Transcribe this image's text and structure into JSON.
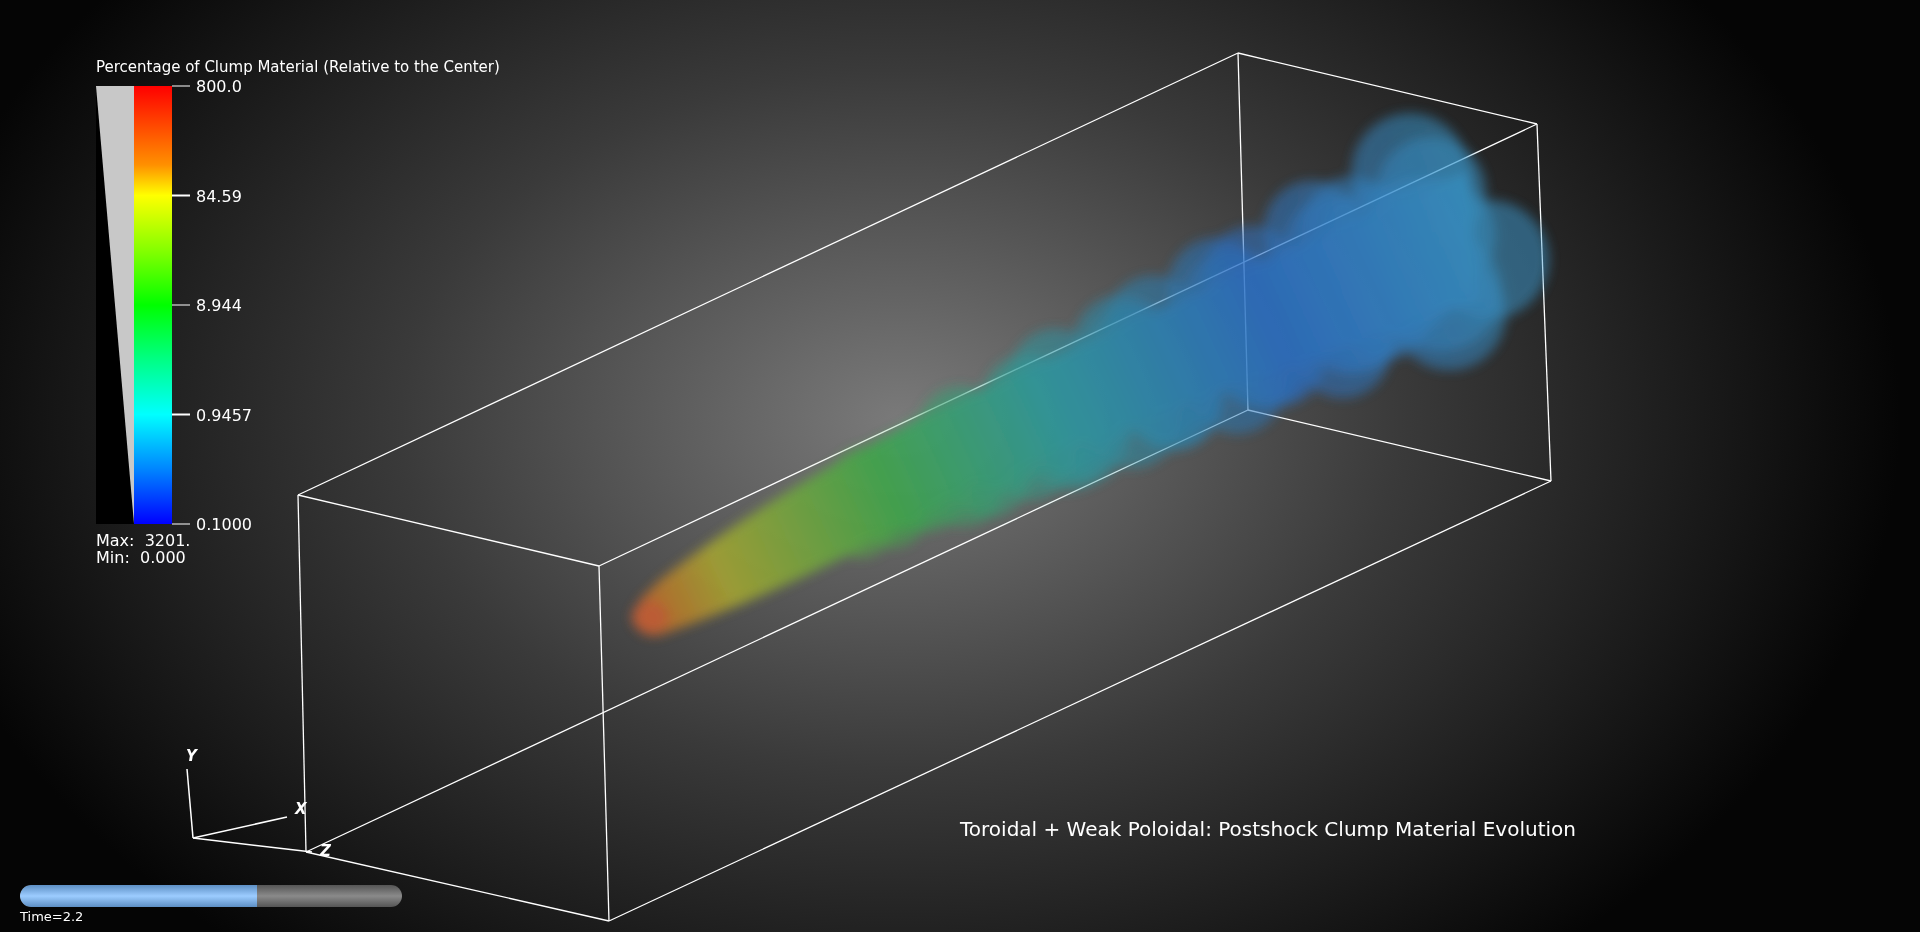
{
  "legend": {
    "title": "Percentage of Clump Material (Relative to the Center)",
    "ticks": [
      "800.0",
      "84.59",
      "8.944",
      "0.9457",
      "0.1000"
    ],
    "max": "Max:  3201.",
    "min": "Min:  0.000"
  },
  "axes": {
    "y_label": "Y",
    "x_label": "X",
    "z_label": "Z"
  },
  "caption": "Toroidal + Weak Poloidal: Postshock Clump Material Evolution",
  "time_slider": {
    "level": 0.62,
    "label": "Time=2.2"
  }
}
